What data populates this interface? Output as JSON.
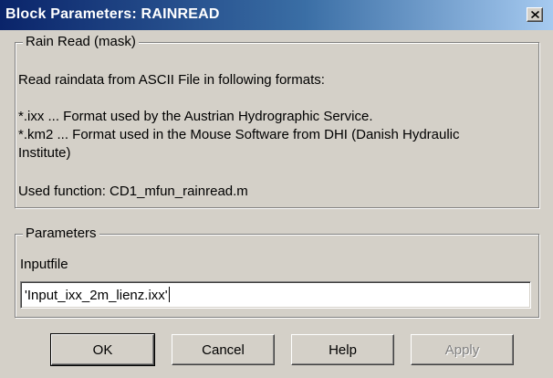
{
  "window": {
    "title": "Block Parameters: RAINREAD"
  },
  "mask_group": {
    "legend": "Rain Read (mask)",
    "description_line1": "Read raindata from ASCII File in following formats:",
    "format_ixx": "*.ixx ... Format used by the Austrian Hydrographic Service.",
    "format_km2_line1": "*.km2 ... Format used in the Mouse Software from DHI (Danish Hydraulic",
    "format_km2_line2": "Institute)",
    "used_function": "Used function: CD1_mfun_rainread.m"
  },
  "parameters_group": {
    "legend": "Parameters",
    "inputfile_label": "Inputfile",
    "inputfile_value": "'Input_ixx_2m_lienz.ixx'"
  },
  "buttons": {
    "ok": "OK",
    "cancel": "Cancel",
    "help": "Help",
    "apply": "Apply"
  },
  "icons": {
    "close": "close-icon"
  },
  "colors": {
    "title_gradient_start": "#0a246a",
    "title_gradient_end": "#a6caf0",
    "dialog_background": "#d4d0c8"
  }
}
